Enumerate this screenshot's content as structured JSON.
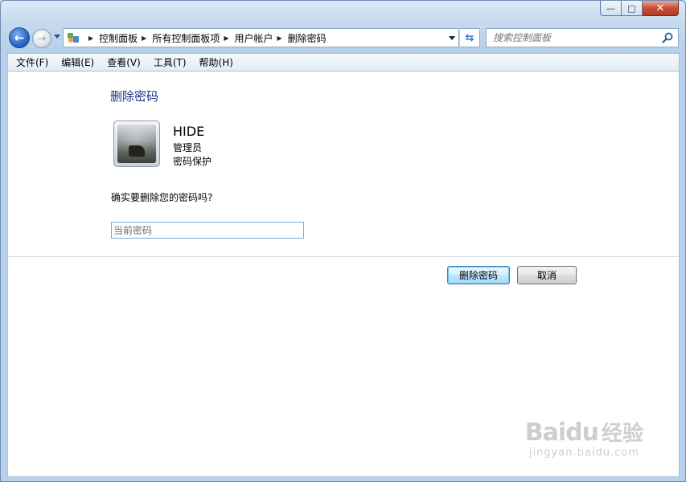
{
  "window": {
    "caption_buttons": {
      "minimize": "—",
      "maximize": "□",
      "close": "✕"
    }
  },
  "nav": {
    "back_icon": "back-arrow-icon",
    "forward_icon": "forward-arrow-icon",
    "breadcrumbs": [
      "控制面板",
      "所有控制面板项",
      "用户帐户",
      "删除密码"
    ],
    "search_placeholder": "搜索控制面板"
  },
  "menu": {
    "items": [
      "文件(F)",
      "编辑(E)",
      "查看(V)",
      "工具(T)",
      "帮助(H)"
    ]
  },
  "main": {
    "heading": "删除密码",
    "user": {
      "name": "HIDE",
      "role": "管理员",
      "status": "密码保护"
    },
    "question": "确实要删除您的密码吗?",
    "password_placeholder": "当前密码",
    "buttons": {
      "delete": "删除密码",
      "cancel": "取消"
    }
  },
  "watermark": {
    "logo": "Baidu",
    "cn": "经验",
    "url": "jingyan.baidu.com"
  },
  "colors": {
    "heading": "#1e3287",
    "close_button": "#c64f39",
    "frame": "#c5d8ee"
  }
}
